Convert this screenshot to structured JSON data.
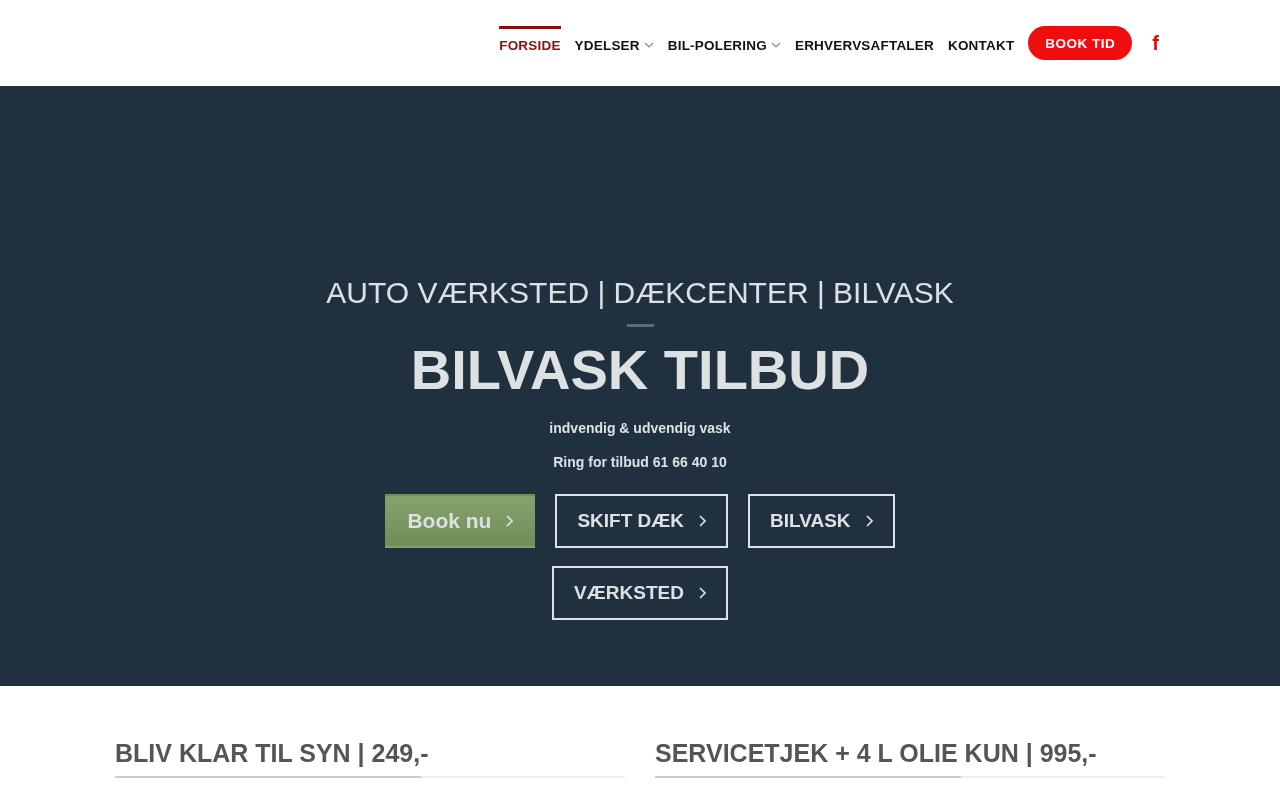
{
  "nav": {
    "items": [
      {
        "label": "FORSIDE",
        "selected": true,
        "dropdown": false
      },
      {
        "label": "YDELSER",
        "selected": false,
        "dropdown": true
      },
      {
        "label": "BIL-POLERING",
        "selected": false,
        "dropdown": true
      },
      {
        "label": "ERHVERVSAFTALER",
        "selected": false,
        "dropdown": false
      },
      {
        "label": "KONTAKT",
        "selected": false,
        "dropdown": false
      }
    ],
    "cta": "BOOK TID",
    "social": "f"
  },
  "hero": {
    "kicker": "AUTO VÆRKSTED | DÆKCENTER | BILVASK",
    "title": "BILVASK TILBUD",
    "lines": [
      "indvendig & udvendig vask",
      "Ring for tilbud 61 66 40 10"
    ],
    "buttons": [
      {
        "label": "Book nu",
        "kind": "primary"
      },
      {
        "label": "SKIFT DÆK",
        "kind": "outline"
      },
      {
        "label": "BILVASK",
        "kind": "outline"
      },
      {
        "label": "VÆRKSTED",
        "kind": "outline"
      }
    ]
  },
  "sections": [
    "BLIV KLAR TIL SYN | 249,-",
    "SERVICETJEK + 4 L OLIE KUN | 995,-"
  ]
}
